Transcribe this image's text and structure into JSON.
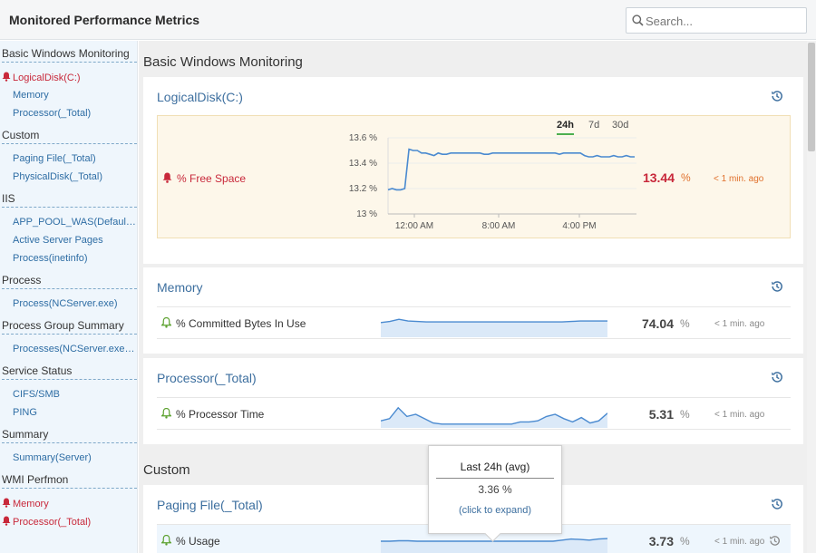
{
  "app": {
    "title": "Monitored Performance Metrics"
  },
  "search": {
    "placeholder": "Search..."
  },
  "sidebar": {
    "groups": [
      {
        "label": "Basic Windows Monitoring",
        "items": [
          {
            "label": "LogicalDisk(C:)",
            "alert": true
          },
          {
            "label": "Memory"
          },
          {
            "label": "Processor(_Total)"
          }
        ]
      },
      {
        "label": "Custom",
        "items": [
          {
            "label": "Paging File(_Total)"
          },
          {
            "label": "PhysicalDisk(_Total)"
          }
        ]
      },
      {
        "label": "IIS",
        "items": [
          {
            "label": "APP_POOL_WAS(DefaultAppPool)"
          },
          {
            "label": "Active Server Pages"
          },
          {
            "label": "Process(inetinfo)"
          }
        ]
      },
      {
        "label": "Process",
        "items": [
          {
            "label": "Process(NCServer.exe)"
          }
        ]
      },
      {
        "label": "Process Group Summary",
        "items": [
          {
            "label": "Processes(NCServer.exe,Perfmon)"
          }
        ]
      },
      {
        "label": "Service Status",
        "items": [
          {
            "label": "CIFS/SMB"
          },
          {
            "label": "PING"
          }
        ]
      },
      {
        "label": "Summary",
        "items": [
          {
            "label": "Summary(Server)"
          }
        ]
      },
      {
        "label": "WMI Perfmon",
        "items": [
          {
            "label": "Memory",
            "alert": true
          },
          {
            "label": "Processor(_Total)",
            "alert": true
          }
        ]
      }
    ]
  },
  "sections": [
    {
      "title": "Basic Windows Monitoring",
      "cards": [
        {
          "title": "LogicalDisk(C:)",
          "metric": {
            "label": "% Free Space",
            "value": "13.44",
            "unit": "%",
            "time": "< 1 min. ago",
            "status": "alert"
          },
          "range_tabs": [
            "24h",
            "7d",
            "30d"
          ],
          "active_range": "24h"
        },
        {
          "title": "Memory",
          "metric": {
            "label": "% Committed Bytes In Use",
            "value": "74.04",
            "unit": "%",
            "time": "< 1 min. ago",
            "status": "ok"
          }
        },
        {
          "title": "Processor(_Total)",
          "metric": {
            "label": "% Processor Time",
            "value": "5.31",
            "unit": "%",
            "time": "< 1 min. ago",
            "status": "ok"
          }
        }
      ]
    },
    {
      "title": "Custom",
      "cards": [
        {
          "title": "Paging File(_Total)",
          "metric": {
            "label": "% Usage",
            "value": "3.73",
            "unit": "%",
            "time": "< 1 min. ago",
            "status": "ok"
          }
        }
      ]
    }
  ],
  "tooltip": {
    "title": "Last 24h (avg)",
    "value": "3.36 %",
    "link": "(click to expand)"
  },
  "chart_data": [
    {
      "type": "line",
      "y_ticks": [
        "13.6 %",
        "13.4 %",
        "13.2 %",
        "13 %"
      ],
      "x_ticks": [
        "12:00 AM",
        "8:00 AM",
        "4:00 PM"
      ],
      "ylim": [
        13.0,
        13.6
      ],
      "series": [
        {
          "values": [
            13.19,
            13.2,
            13.19,
            13.19,
            13.2,
            13.51,
            13.5,
            13.5,
            13.48,
            13.48,
            13.47,
            13.46,
            13.48,
            13.47,
            13.47,
            13.48,
            13.48,
            13.48,
            13.48,
            13.48,
            13.48,
            13.48,
            13.48,
            13.47,
            13.47,
            13.48,
            13.48,
            13.48,
            13.48,
            13.48,
            13.48,
            13.48,
            13.48,
            13.48,
            13.48,
            13.48,
            13.48,
            13.48,
            13.48,
            13.48,
            13.48,
            13.47,
            13.48,
            13.48,
            13.48,
            13.48,
            13.48,
            13.46,
            13.45,
            13.45,
            13.46,
            13.45,
            13.45,
            13.45,
            13.46,
            13.45,
            13.45,
            13.46,
            13.45,
            13.45
          ]
        }
      ]
    }
  ],
  "sparklines": {
    "memory": [
      0.55,
      0.6,
      0.7,
      0.62,
      0.6,
      0.58,
      0.58,
      0.58,
      0.58,
      0.58,
      0.58,
      0.58,
      0.58,
      0.58,
      0.58,
      0.58,
      0.58,
      0.58,
      0.58,
      0.58,
      0.58,
      0.6,
      0.62,
      0.62,
      0.62,
      0.62
    ],
    "processor": [
      0.2,
      0.3,
      0.8,
      0.4,
      0.5,
      0.3,
      0.1,
      0.05,
      0.05,
      0.05,
      0.05,
      0.05,
      0.05,
      0.05,
      0.05,
      0.05,
      0.15,
      0.15,
      0.2,
      0.4,
      0.5,
      0.3,
      0.15,
      0.35,
      0.1,
      0.2,
      0.55
    ],
    "paging": [
      0.5,
      0.5,
      0.52,
      0.52,
      0.5,
      0.5,
      0.5,
      0.5,
      0.5,
      0.5,
      0.5,
      0.5,
      0.5,
      0.5,
      0.5,
      0.5,
      0.5,
      0.5,
      0.5,
      0.5,
      0.55,
      0.6,
      0.58,
      0.55,
      0.6,
      0.62
    ]
  }
}
